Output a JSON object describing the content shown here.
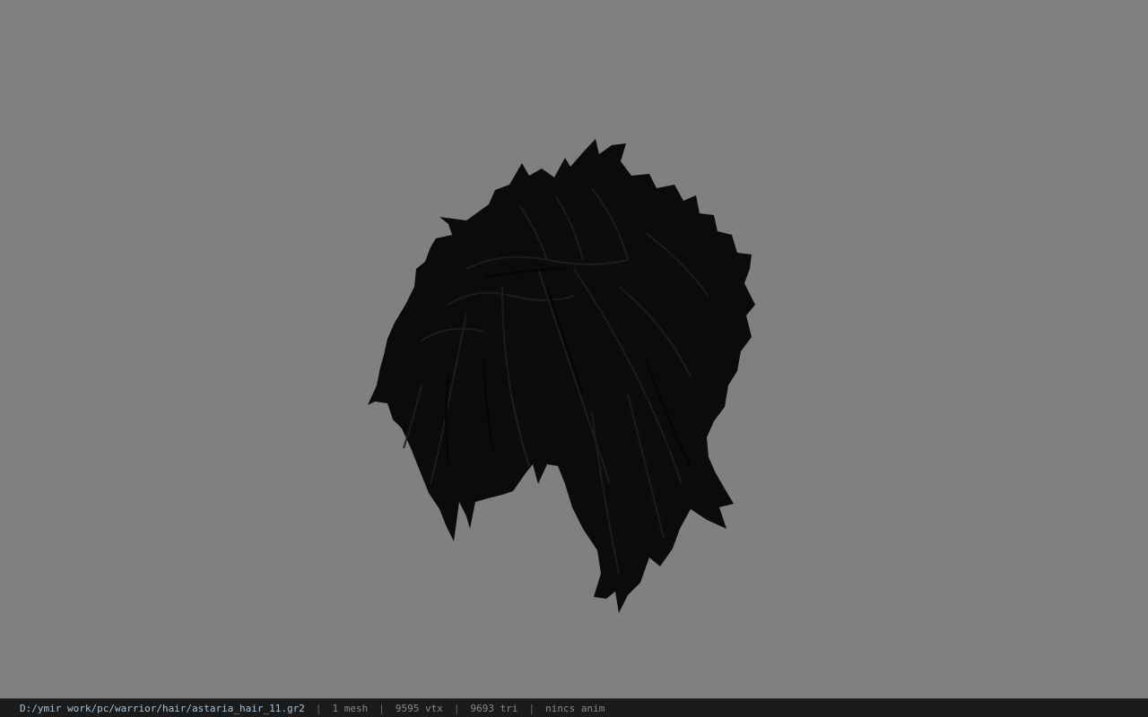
{
  "viewport": {
    "background_color": "#808080",
    "model": {
      "icon": "hair-model",
      "color": "#0c0c0c"
    }
  },
  "statusbar": {
    "file_path": "D:/ymir work/pc/warrior/hair/astaria_hair_11.gr2",
    "separator": "|",
    "mesh_count": "1 mesh",
    "vertex_count": "9595 vtx",
    "triangle_count": "9693 tri",
    "animation": "nincs anim"
  }
}
